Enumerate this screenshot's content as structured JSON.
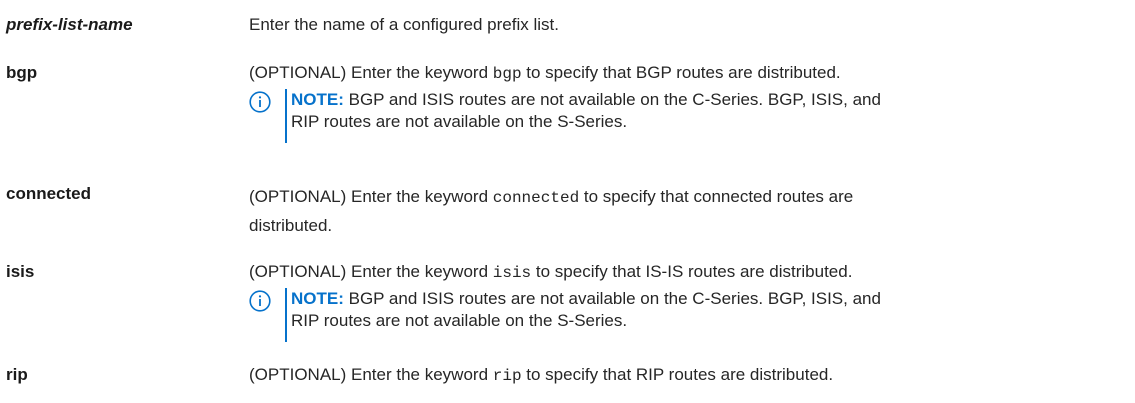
{
  "rows": [
    {
      "term": "prefix-list-name",
      "desc_line1": "Enter the name of a configured prefix list."
    },
    {
      "term": "bgp",
      "desc_pre": "(OPTIONAL) Enter the keyword ",
      "desc_kw": "bgp",
      "desc_post": " to specify that BGP routes are distributed.",
      "note_label": "NOTE:",
      "note_line1": " BGP and ISIS routes are not available on the C-Series. BGP, ISIS, and",
      "note_line2": "RIP routes are not available on the S-Series."
    },
    {
      "term": "connected",
      "desc_pre": "(OPTIONAL) Enter the keyword ",
      "desc_kw": "connected",
      "desc_post": " to specify that connected routes are",
      "desc_line2": "distributed."
    },
    {
      "term": "isis",
      "desc_pre": "(OPTIONAL) Enter the keyword ",
      "desc_kw": "isis",
      "desc_post": " to specify that IS-IS routes are distributed.",
      "note_label": "NOTE:",
      "note_line1": " BGP and ISIS routes are not available on the C-Series. BGP, ISIS, and",
      "note_line2": "RIP routes are not available on the S-Series."
    },
    {
      "term": "rip",
      "desc_pre": "(OPTIONAL) Enter the keyword ",
      "desc_kw": "rip",
      "desc_post": " to specify that RIP routes are distributed."
    }
  ],
  "icons": {
    "note_icon": "info-circle-icon",
    "accent_color": "#0672cb"
  }
}
